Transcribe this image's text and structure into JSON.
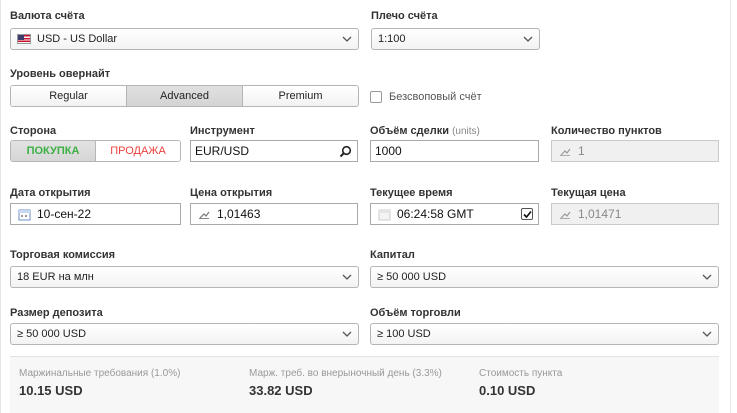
{
  "account_currency": {
    "label": "Валюта счёта",
    "value": "USD - US Dollar",
    "flag_icon": "us-flag-icon"
  },
  "leverage": {
    "label": "Плечо счёта",
    "value": "1:100"
  },
  "overnight_level": {
    "label": "Уровень овернайт",
    "options": [
      "Regular",
      "Advanced",
      "Premium"
    ],
    "selected": "Advanced"
  },
  "swap_free": {
    "label": "Безсвоповый счёт",
    "checked": false
  },
  "side": {
    "label": "Сторона",
    "buy": "ПОКУПКА",
    "sell": "ПРОДАЖА",
    "selected": "ПОКУПКА",
    "buy_color": "#3cb043",
    "sell_color": "#e8413c"
  },
  "instrument": {
    "label": "Инструмент",
    "value": "EUR/USD"
  },
  "trade_volume": {
    "label": "Объём сделки",
    "unit": "(units)",
    "value": "1000"
  },
  "pip_count": {
    "label": "Количество пунктов",
    "value": "1"
  },
  "open_date": {
    "label": "Дата открытия",
    "value": "10-сен-22"
  },
  "open_price": {
    "label": "Цена открытия",
    "value": "1,01463"
  },
  "current_time": {
    "label": "Текущее время",
    "value": "06:24:58 GMT",
    "checked": true
  },
  "current_price": {
    "label": "Текущая цена",
    "value": "1,01471"
  },
  "commission": {
    "label": "Торговая комиссия",
    "value": "18 EUR на млн"
  },
  "capital": {
    "label": "Капитал",
    "value": "≥ 50 000 USD"
  },
  "deposit_size": {
    "label": "Размер депозита",
    "value": "≥ 50 000 USD"
  },
  "trade_volume_total": {
    "label": "Объём торговли",
    "value": "≥ 100 USD"
  },
  "summary": {
    "margin": {
      "label": "Маржинальные требования (1.0%)",
      "value": "10.15 USD"
    },
    "overnight_margin": {
      "label": "Марж. треб. во внерыночный день (3.3%)",
      "value": "33.82 USD"
    },
    "pip_value": {
      "label": "Стоимость пункта",
      "value": "0.10 USD"
    }
  }
}
